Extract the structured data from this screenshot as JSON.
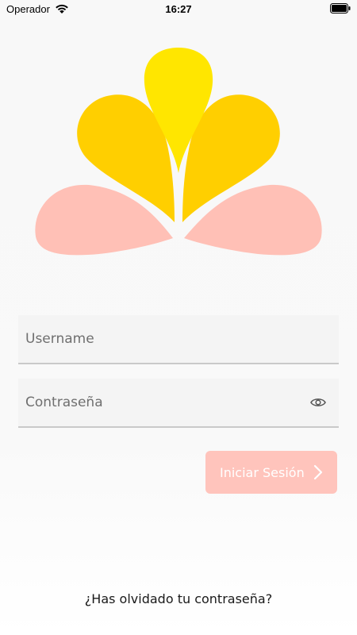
{
  "status_bar": {
    "carrier": "Operador",
    "time": "16:27",
    "wifi_icon": "wifi-icon",
    "battery_icon": "battery-icon"
  },
  "logo": {
    "icon": "flower-logo-icon",
    "colors": {
      "petal_yellow": "#ffe600",
      "petal_gold": "#ffcf00",
      "petal_pink": "#ffc0b6"
    }
  },
  "login_form": {
    "username_placeholder": "Username",
    "password_placeholder": "Contraseña",
    "password_toggle_icon": "eye-icon",
    "submit_label": "Iniciar Sesión",
    "submit_icon": "chevron-right-icon",
    "submit_color": "#ffc4bc"
  },
  "forgot_password": "¿Has olvidado tu contraseña?"
}
